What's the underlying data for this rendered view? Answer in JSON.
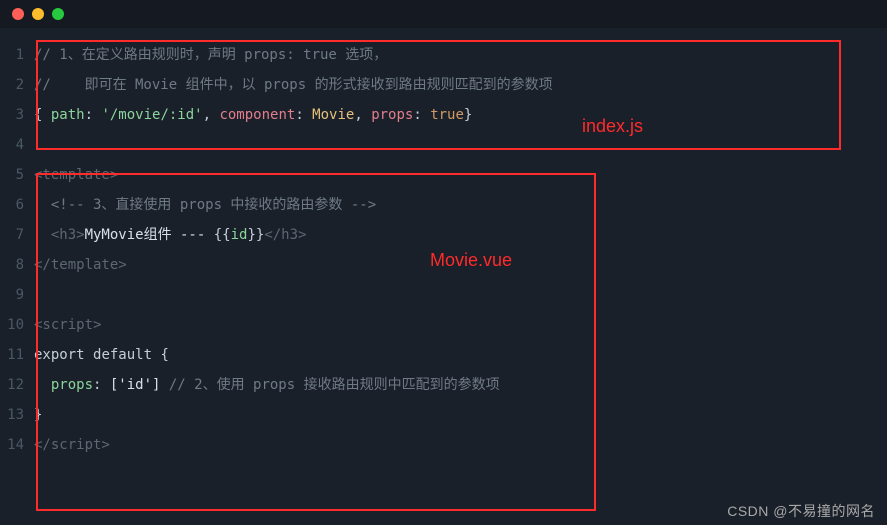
{
  "titlebar": {
    "dots": [
      "red",
      "yellow",
      "green"
    ]
  },
  "labels": {
    "file1": "index.js",
    "file2": "Movie.vue"
  },
  "watermark": "CSDN @不易撞的网名",
  "code": {
    "l1_comment": "// 1、在定义路由规则时，声明 props: true 选项，",
    "l2_comment": "//    即可在 Movie 组件中，以 props 的形式接收到路由规则匹配到的参数项",
    "l3": {
      "open": "{ ",
      "k_path": "path",
      "colon1": ": ",
      "v_path": "'/movie/:id'",
      "comma1": ", ",
      "k_comp": "component",
      "colon2": ": ",
      "v_comp": "Movie",
      "comma2": ", ",
      "k_props": "props",
      "colon3": ": ",
      "v_props": "true",
      "close": "}"
    },
    "l5_open_template": "<template>",
    "l6_comment": "<!-- 3、直接使用 props 中接收的路由参数 -->",
    "l7": {
      "open_h3": "<h3>",
      "text1": "MyMovie组件 --- ",
      "interp_open": "{{",
      "interp_var": "id",
      "interp_close": "}}",
      "close_h3": "</h3>"
    },
    "l8_close_template": "</template>",
    "l10_open_script": "<script>",
    "l11": {
      "export": "export ",
      "default": "default ",
      "brace": "{"
    },
    "l12": {
      "indent": "  ",
      "k_props": "props",
      "colon": ": ",
      "arr": "['id']",
      "comment": " // 2、使用 props 接收路由规则中匹配到的参数项"
    },
    "l13_close_brace": "}",
    "l14_close_script": "</script>"
  },
  "gutter": [
    "1",
    "2",
    "3",
    "4",
    "5",
    "6",
    "7",
    "8",
    "9",
    "10",
    "11",
    "12",
    "13",
    "14"
  ]
}
